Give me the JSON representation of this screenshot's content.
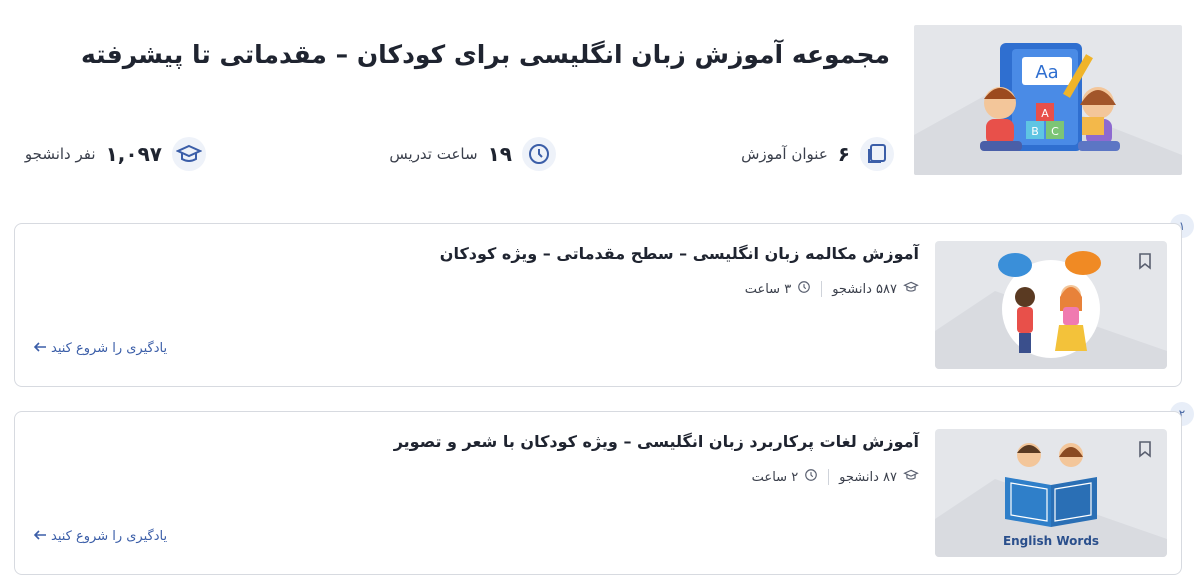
{
  "header": {
    "title": "مجموعه آموزش زبان انگلیسی برای کودکان – مقدماتی تا پیشرفته",
    "stats": {
      "courses": {
        "value": "۶",
        "label": "عنوان آموزش",
        "icon": "book-stack-icon"
      },
      "hours": {
        "value": "۱۹",
        "label": "ساعت تدریس",
        "icon": "clock-icon"
      },
      "students": {
        "value": "۱,۰۹۷",
        "label": "نفر دانشجو",
        "icon": "graduation-cap-icon"
      }
    }
  },
  "courses": [
    {
      "index": "۱",
      "title": "آموزش مکالمه زبان انگلیسی – سطح مقدماتی – ویژه کودکان",
      "students": "۵۸۷ دانشجو",
      "duration": "۳ ساعت",
      "cta": "یادگیری را شروع کنید"
    },
    {
      "index": "۲",
      "title": "آموزش لغات پرکاربرد زبان انگلیسی – ویژه کودکان با شعر و تصویر",
      "students": "۸۷ دانشجو",
      "duration": "۲ ساعت",
      "cta": "یادگیری را شروع کنید",
      "thumb_caption": "English Words"
    }
  ],
  "hero_illustration": {
    "letters": "Aa",
    "blocks": [
      "A",
      "B",
      "C"
    ]
  },
  "colors": {
    "accent": "#3b5ea8",
    "icon_bg": "#eef2f9",
    "thumb_bg": "#e4e6ea",
    "border": "#d7dae0"
  }
}
